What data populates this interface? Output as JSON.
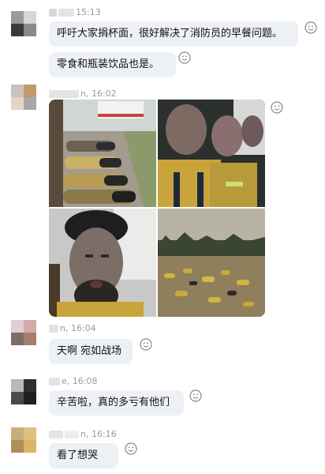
{
  "messages": [
    {
      "time": "15:13",
      "text": "呼吁大家捐杯面，很好解决了消防员的早餐问题。"
    },
    {
      "time": null,
      "text": "零食和瓶装饮品也是。"
    },
    {
      "time": "16:02",
      "name_tail": "n,",
      "photos": [
        "firefighters-sleeping-on-street",
        "firefighters-resting-in-truck",
        "exhausted-firefighter-selfie",
        "firefighters-resting-in-field"
      ]
    },
    {
      "time": "16:04",
      "name_tail": "n,",
      "text": "天啊 宛如战场"
    },
    {
      "time": "16:08",
      "name_tail": "e,",
      "text": "辛苦啦，真的多亏有他们"
    },
    {
      "time": "16:16",
      "name_tail": "n,",
      "text": "看了想哭"
    }
  ],
  "icons": {
    "reaction": "smiley-icon",
    "avatar": "pixelated-avatar"
  },
  "colors": {
    "bubble": "#edf1f6",
    "meta": "#9a9a9a",
    "background": "#ffffff"
  }
}
